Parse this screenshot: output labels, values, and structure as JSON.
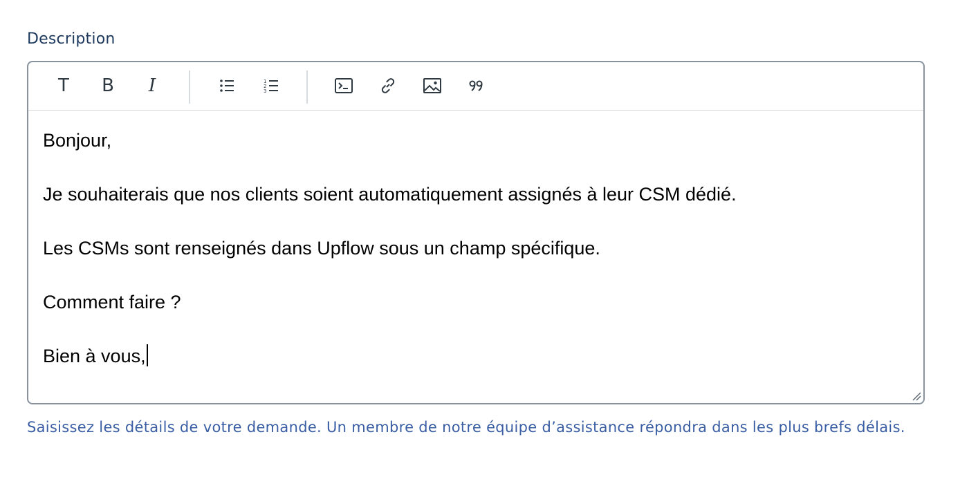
{
  "field": {
    "label": "Description",
    "hint": "Saisissez les détails de votre demande. Un membre de notre équipe d’assistance répondra dans les plus brefs délais."
  },
  "toolbar": {
    "text_style_label": "T",
    "bold_label": "B",
    "italic_label": "I",
    "buttons": [
      {
        "name": "text-style",
        "icon": "text-style-icon"
      },
      {
        "name": "bold",
        "icon": "bold-icon"
      },
      {
        "name": "italic",
        "icon": "italic-icon"
      },
      {
        "name": "bulleted-list",
        "icon": "bulleted-list-icon"
      },
      {
        "name": "numbered-list",
        "icon": "numbered-list-icon"
      },
      {
        "name": "code-block",
        "icon": "code-block-icon"
      },
      {
        "name": "link",
        "icon": "link-icon"
      },
      {
        "name": "image",
        "icon": "image-icon"
      },
      {
        "name": "quote",
        "icon": "quote-icon"
      }
    ]
  },
  "editor": {
    "paragraphs": [
      "Bonjour,",
      "Je souhaiterais que nos clients soient automatiquement assignés à leur CSM dédié.",
      "Les CSMs sont renseignés dans Upflow sous un champ spécifique.",
      "Comment faire ?",
      "Bien à vous,"
    ]
  },
  "colors": {
    "label": "#1f3a5f",
    "hint": "#3a5ea3",
    "border": "#87929d",
    "icon": "#2f3941",
    "divider": "#d8dcde"
  }
}
